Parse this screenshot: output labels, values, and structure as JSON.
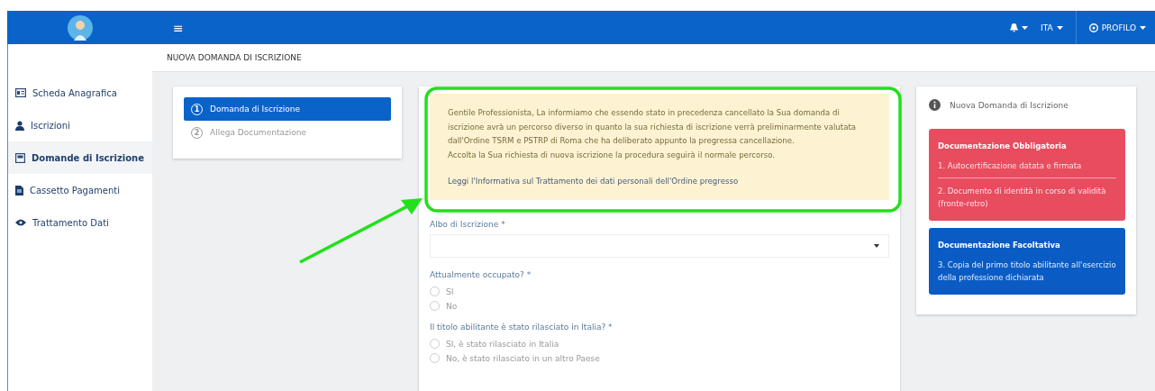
{
  "topbar": {
    "menu_glyph": "≡",
    "lang": "ITA",
    "profile": "PROFILO"
  },
  "sidebar": {
    "items": [
      {
        "label": "Scheda Anagrafica",
        "kind": "card",
        "selected": false
      },
      {
        "label": "Iscrizioni",
        "kind": "user",
        "selected": false
      },
      {
        "label": "Domande di Iscrizione",
        "kind": "form",
        "selected": true
      },
      {
        "label": "Cassetto Pagamenti",
        "kind": "doc",
        "selected": false
      },
      {
        "label": "Trattamento Dati",
        "kind": "eye",
        "selected": false
      }
    ]
  },
  "page_title": "NUOVA DOMANDA DI ISCRIZIONE",
  "steps": [
    {
      "number": "1",
      "label": "Domanda di Iscrizione",
      "selected": true
    },
    {
      "number": "2",
      "label": "Allega Documentazione",
      "selected": false
    }
  ],
  "notice": {
    "paragraphs": [
      "Gentile Professionista, La informiamo che essendo stato in precedenza cancellato la Sua domanda di iscrizione avrà un percorso diverso in quanto la sua richiesta di iscrizione verrà preliminarmente valutata dall'Ordine TSRM e PSTRP di Roma che ha deliberato appunto la pregressa cancellazione.",
      "Accolta la Sua richiesta di nuova iscrizione la procedura seguirà il normale percorso."
    ],
    "link": "Leggi l'Informativa sul Trattamento dei dati personali dell'Ordine pregresso"
  },
  "form": {
    "fields": [
      {
        "kind": "select",
        "label": "Albo di Iscrizione *"
      },
      {
        "kind": "radio",
        "label": "Attualmente occupato? *",
        "options": [
          {
            "label": "SI",
            "selected": false
          },
          {
            "label": "No",
            "selected": false
          }
        ]
      },
      {
        "kind": "radio",
        "label": "Il titolo abilitante è stato rilasciato in Italia? *",
        "options": [
          {
            "label": "SI, è stato rilasciato in Italia",
            "selected": false
          },
          {
            "label": "No, è stato rilasciato in un altro Paese",
            "selected": false
          }
        ]
      }
    ]
  },
  "info_panel": {
    "title": "Nuova Domanda di Iscrizione",
    "boxes": [
      {
        "kind": "required",
        "heading": "Documentazione Obbligatoria",
        "items": [
          "1. Autocertificazione datata e firmata",
          "2. Documento di identità in corso di validità (fronte-retro)"
        ]
      },
      {
        "kind": "optional",
        "heading": "Documentazione Facoltativa",
        "items": [
          "3. Copia del primo titolo abilitante all'esercizio della professione dichiarata"
        ]
      }
    ]
  }
}
